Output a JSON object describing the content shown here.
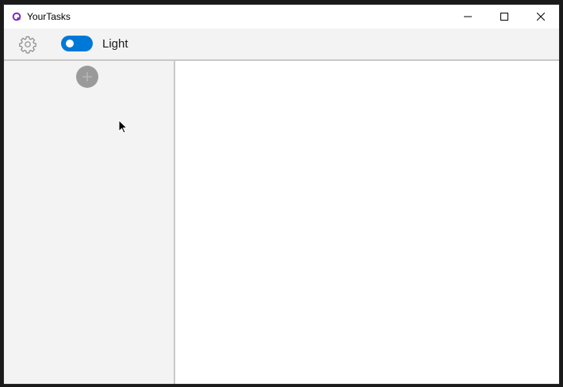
{
  "window": {
    "title": "YourTasks",
    "app_icon": "app-logo-icon",
    "caption_buttons": [
      "minimize-icon",
      "maximize-icon",
      "close-icon"
    ]
  },
  "toolbar": {
    "settings_icon": "gear-icon",
    "theme_toggle": {
      "state": "on",
      "label": "Light"
    }
  },
  "sidebar": {
    "add_button_icon": "plus-icon",
    "items": []
  },
  "content": {},
  "colors": {
    "accent": "#0078d7",
    "toolbar_bg": "#f3f3f3",
    "sidebar_bg": "#f3f3f3",
    "add_button": "#9a9a9a",
    "app_icon": "#7b2fbe"
  }
}
